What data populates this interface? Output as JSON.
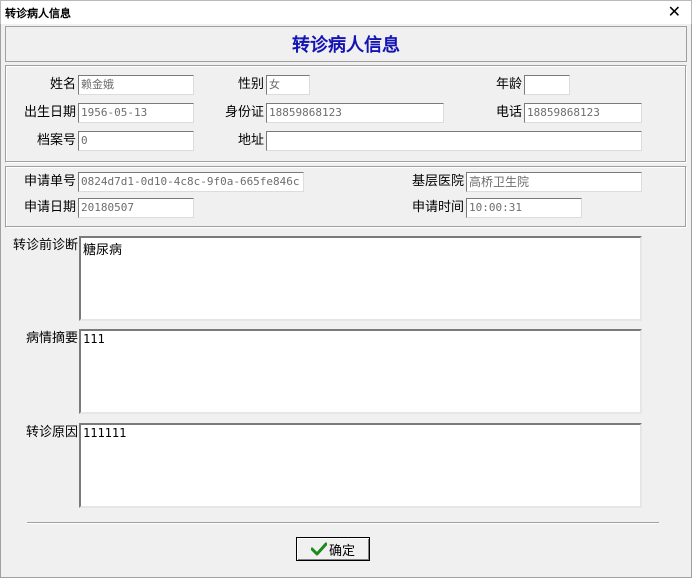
{
  "window": {
    "title": "转诊病人信息",
    "close_glyph": "✕"
  },
  "header": {
    "title": "转诊病人信息"
  },
  "patient": {
    "name_label": "姓名",
    "name": "赖金娥",
    "gender_label": "性别",
    "gender": "女",
    "age_label": "年龄",
    "age": "",
    "dob_label": "出生日期",
    "dob": "1956-05-13",
    "id_label": "身份证",
    "id": "18859868123",
    "phone_label": "电话",
    "phone": "18859868123",
    "file_label": "档案号",
    "file": "0",
    "address_label": "地址",
    "address": ""
  },
  "request": {
    "no_label": "申请单号",
    "no": "0824d7d1-0d10-4c8c-9f0a-665fe846c",
    "hospital_label": "基层医院",
    "hospital": "高桥卫生院",
    "date_label": "申请日期",
    "date": "20180507",
    "time_label": "申请时间",
    "time": "10:00:31"
  },
  "notes": {
    "diagnosis_label": "转诊前诊断",
    "diagnosis": "糖尿病",
    "summary_label": "病情摘要",
    "summary": "111",
    "reason_label": "转诊原因",
    "reason": "111111"
  },
  "footer": {
    "ok_label": "确定",
    "ok_icon": "check-icon",
    "ok_icon_color": "#1a8a1a"
  },
  "colors": {
    "header_title": "#1414b4"
  }
}
